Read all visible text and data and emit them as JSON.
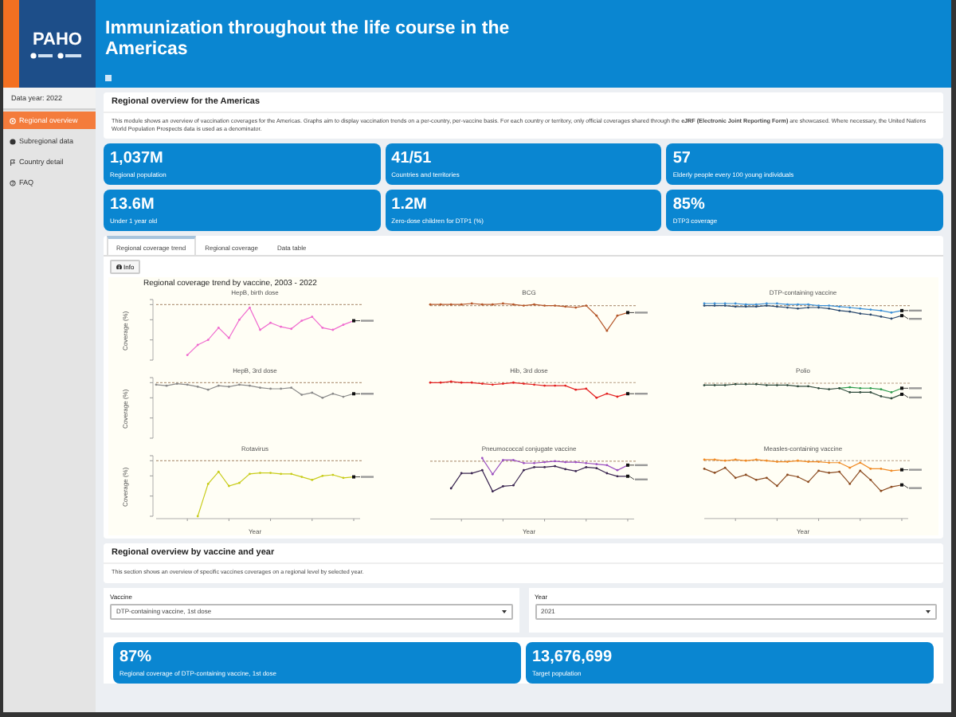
{
  "header": {
    "logo": "PAHO",
    "title": "Immunization throughout the life course in the Americas"
  },
  "sidebar": {
    "data_year": "Data year: 2022",
    "items": [
      {
        "label": "Regional overview",
        "selected": true
      },
      {
        "label": "Subregional data",
        "selected": false
      },
      {
        "label": "Country detail",
        "selected": false
      },
      {
        "label": "FAQ",
        "selected": false
      }
    ]
  },
  "overview": {
    "title": "Regional overview for the Americas",
    "description": "This module shows an overview of vaccination coverages for the Americas. Graphs aim to display vaccination trends on a per-country, per-vaccine basis. For each country or territory, only official coverages shared through the **eJRF (Electronic Joint Reporting Form)** are showcased. Where necessary, the United Nations World Population Prospects data is used as a denominator."
  },
  "kpis": [
    {
      "value": "1,037M",
      "label": "Regional population"
    },
    {
      "value": "41/51",
      "label": "Countries and territories"
    },
    {
      "value": "57",
      "label": "Elderly people every 100 young individuals"
    },
    {
      "value": "13.6M",
      "label": "Under 1 year old"
    },
    {
      "value": "1.2M",
      "label": "Zero-dose children for DTP1 (%)"
    },
    {
      "value": "85%",
      "label": "DTP3 coverage"
    }
  ],
  "tabs": [
    {
      "label": "Regional coverage trend",
      "selected": true
    },
    {
      "label": "Regional coverage",
      "selected": false
    },
    {
      "label": "Data table",
      "selected": false
    }
  ],
  "info_button": "Info",
  "trend_title": "Regional coverage trend by vaccine, 2003 - 2022",
  "panels": [
    {
      "title": "HepB, birth dose",
      "ylabel": "Coverage (%)"
    },
    {
      "title": "BCG"
    },
    {
      "title": "DTP-containing vaccine"
    },
    {
      "title": "HepB, 3rd dose",
      "ylabel": "Coverage (%)"
    },
    {
      "title": "Hib, 3rd dose"
    },
    {
      "title": "Polio"
    },
    {
      "title": "Rotavirus",
      "ylabel": "Coverage (%)",
      "xlabel": "Year"
    },
    {
      "title": "Pneumococcal conjugate vaccine",
      "xlabel": "Year"
    },
    {
      "title": "Measles-containing vaccine",
      "xlabel": "Year"
    }
  ],
  "by_vaccine": {
    "title": "Regional overview by vaccine and year",
    "description": "This section shows an overview of specific vaccines coverages on a regional level by selected year."
  },
  "selects": [
    {
      "label": "Vaccine",
      "value": "DTP-containing vaccine, 1st dose"
    },
    {
      "label": "Year",
      "value": "2021"
    }
  ],
  "vaccine_kpis": [
    {
      "value": "87%",
      "label": "Regional coverage of DTP-containing vaccine, 1st dose"
    },
    {
      "value": "13,676,699",
      "label": "Target population"
    }
  ]
}
